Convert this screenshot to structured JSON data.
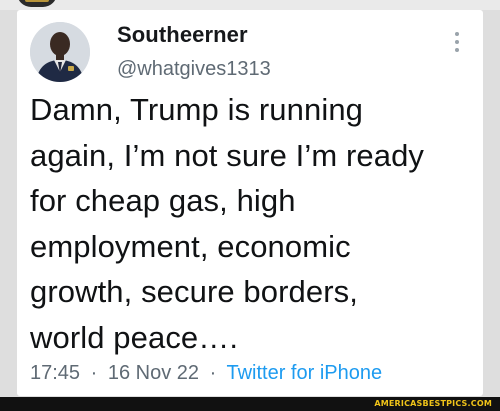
{
  "tweet": {
    "display_name": "Southeerner",
    "handle": "@whatgives1313",
    "text": "Damn, Trump is running\nagain, I’m not sure I’m ready\nfor cheap gas, high\nemployment, economic\ngrowth, secure borders,\nworld peace….",
    "time": "17:45",
    "separator": "·",
    "date": "16 Nov 22",
    "source": "Twitter for iPhone",
    "avatar_icon": "profile-photo-icon",
    "more_icon": "vertical-ellipsis-icon"
  },
  "watermark": {
    "text": "AMERICASBESTPICS.COM",
    "color": "#f0c419"
  },
  "colors": {
    "link": "#1d9bf0",
    "secondary_text": "#5f6a74",
    "primary_text": "#101214",
    "card_background": "#ffffff"
  }
}
